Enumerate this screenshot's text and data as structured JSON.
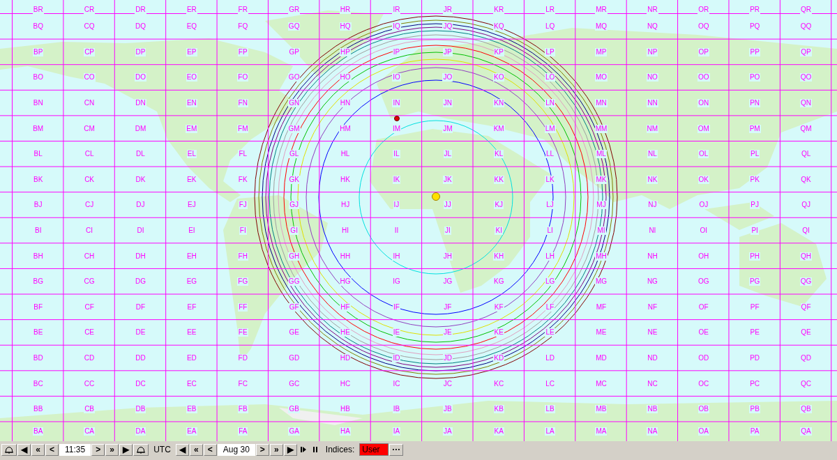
{
  "grid": {
    "rows": [
      [
        "BR",
        "CR",
        "DR",
        "ER",
        "FR",
        "GR",
        "HR",
        "IR",
        "JR",
        "KR",
        "LR",
        "MR",
        "NR",
        "OR",
        "PR",
        "QR"
      ],
      [
        "BQ",
        "CQ",
        "DQ",
        "EQ",
        "FQ",
        "GQ",
        "HQ",
        "IQ",
        "JQ",
        "KQ",
        "LQ",
        "MQ",
        "NQ",
        "OQ",
        "PQ",
        "QQ"
      ],
      [
        "BP",
        "CP",
        "DP",
        "EP",
        "FP",
        "GP",
        "HP",
        "IP",
        "JP",
        "KP",
        "LP",
        "MP",
        "NP",
        "OP",
        "PP",
        "QP"
      ],
      [
        "BO",
        "CO",
        "DO",
        "EO",
        "FO",
        "GO",
        "HO",
        "IO",
        "JO",
        "KO",
        "LO",
        "MO",
        "NO",
        "OO",
        "PO",
        "QO"
      ],
      [
        "BN",
        "CN",
        "DN",
        "EN",
        "FN",
        "GN",
        "HN",
        "IN",
        "JN",
        "KN",
        "LN",
        "MN",
        "NN",
        "ON",
        "PN",
        "QN"
      ],
      [
        "BM",
        "CM",
        "DM",
        "EM",
        "FM",
        "GM",
        "HM",
        "IM",
        "JM",
        "KM",
        "LM",
        "MM",
        "NM",
        "OM",
        "PM",
        "QM"
      ],
      [
        "BL",
        "CL",
        "DL",
        "EL",
        "FL",
        "GL",
        "HL",
        "IL",
        "JL",
        "KL",
        "LL",
        "ML",
        "NL",
        "OL",
        "PL",
        "QL"
      ],
      [
        "BK",
        "CK",
        "DK",
        "EK",
        "FK",
        "GK",
        "HK",
        "IK",
        "JK",
        "KK",
        "LK",
        "MK",
        "NK",
        "OK",
        "PK",
        "QK"
      ],
      [
        "BJ",
        "CJ",
        "DJ",
        "EJ",
        "FJ",
        "GJ",
        "HJ",
        "IJ",
        "JJ",
        "KJ",
        "LJ",
        "MJ",
        "NJ",
        "OJ",
        "PJ",
        "QJ"
      ],
      [
        "BI",
        "CI",
        "DI",
        "EI",
        "FI",
        "GI",
        "HI",
        "II",
        "JI",
        "KI",
        "LI",
        "MI",
        "NI",
        "OI",
        "PI",
        "QI"
      ],
      [
        "BH",
        "CH",
        "DH",
        "EH",
        "FH",
        "GH",
        "HH",
        "IH",
        "JH",
        "KH",
        "LH",
        "MH",
        "NH",
        "OH",
        "PH",
        "QH"
      ],
      [
        "BG",
        "CG",
        "DG",
        "EG",
        "FG",
        "GG",
        "HG",
        "IG",
        "JG",
        "KG",
        "LG",
        "MG",
        "NG",
        "OG",
        "PG",
        "QG"
      ],
      [
        "BF",
        "CF",
        "DF",
        "EF",
        "FF",
        "GF",
        "HF",
        "IF",
        "JF",
        "KF",
        "LF",
        "MF",
        "NF",
        "OF",
        "PF",
        "QF"
      ],
      [
        "BE",
        "CE",
        "DE",
        "EE",
        "FE",
        "GE",
        "HE",
        "IE",
        "JE",
        "KE",
        "LE",
        "ME",
        "NE",
        "OE",
        "PE",
        "QE"
      ],
      [
        "BD",
        "CD",
        "DD",
        "ED",
        "FD",
        "GD",
        "HD",
        "ID",
        "JD",
        "KD",
        "LD",
        "MD",
        "ND",
        "OD",
        "PD",
        "QD"
      ],
      [
        "BC",
        "CC",
        "DC",
        "EC",
        "FC",
        "GC",
        "HC",
        "IC",
        "JC",
        "KC",
        "LC",
        "MC",
        "NC",
        "OC",
        "PC",
        "QC"
      ],
      [
        "BB",
        "CB",
        "DB",
        "EB",
        "FB",
        "GB",
        "HB",
        "IB",
        "JB",
        "KB",
        "LB",
        "MB",
        "NB",
        "OB",
        "PB",
        "QB"
      ],
      [
        "BA",
        "CA",
        "DA",
        "EA",
        "FA",
        "GA",
        "HA",
        "IA",
        "JA",
        "KA",
        "LA",
        "MA",
        "NA",
        "OA",
        "PA",
        "QA"
      ]
    ]
  },
  "toolbar": [
    {
      "kind": "bell"
    },
    {
      "kind": "button",
      "label": "◀"
    },
    {
      "kind": "button",
      "label": "«"
    },
    {
      "kind": "button",
      "label": "<"
    },
    {
      "kind": "value",
      "text": "11:35"
    },
    {
      "kind": "button",
      "label": ">"
    },
    {
      "kind": "button",
      "label": "»"
    },
    {
      "kind": "button",
      "label": "▶"
    },
    {
      "kind": "bell"
    },
    {
      "kind": "label",
      "text": "UTC"
    },
    {
      "kind": "button",
      "label": "◀"
    },
    {
      "kind": "button",
      "label": "«"
    },
    {
      "kind": "button",
      "label": "<"
    },
    {
      "kind": "value",
      "text": "Aug 30"
    },
    {
      "kind": "button",
      "label": ">"
    },
    {
      "kind": "button",
      "label": "»"
    },
    {
      "kind": "button",
      "label": "▶"
    },
    {
      "kind": "step"
    },
    {
      "kind": "pause"
    },
    {
      "kind": "label",
      "text": "Indices:"
    },
    {
      "kind": "indicator",
      "text": "User",
      "color": "#ff0000"
    },
    {
      "kind": "button",
      "label": "···"
    }
  ]
}
